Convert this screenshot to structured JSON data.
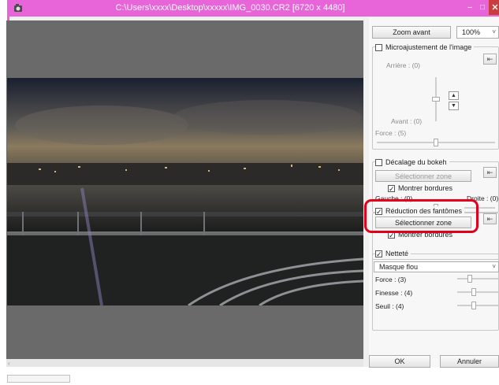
{
  "window": {
    "title": "C:\\Users\\xxxx\\Desktop\\xxxxx\\IMG_0030.CR2 [6720 x 4480]",
    "controls": {
      "minimize": "–",
      "maximize": "□"
    },
    "titlebar_color": "#e865d9",
    "close_color": "#c93d3d"
  },
  "toolbar": {
    "zoom_button": "Zoom avant",
    "zoom_level": "100%"
  },
  "micro": {
    "label": "Microajustement de l'image",
    "checked": false,
    "arriere": "Arrière : (0)",
    "avant": "Avant : (0)",
    "force": "Force : (5)",
    "arriere_value": 0,
    "force_value": 5
  },
  "bokeh": {
    "label": "Décalage du bokeh",
    "checked": false,
    "select_zone": "Sélectionner zone",
    "show_borders": "Montrer bordures",
    "show_borders_checked": true,
    "left": "Gauche : (0)",
    "right": "Droite : (0)",
    "value": 0
  },
  "ghost": {
    "label": "Réduction des fantômes",
    "checked": true,
    "select_zone": "Sélectionner zone",
    "show_borders": "Montrer bordures",
    "show_borders_checked": true
  },
  "sharpness": {
    "label": "Netteté",
    "checked": true,
    "mode": "Masque flou",
    "force": "Force : (3)",
    "finesse": "Finesse : (4)",
    "seuil": "Seuil : (4)",
    "force_value": 3,
    "finesse_value": 4,
    "seuil_value": 4
  },
  "footer": {
    "ok": "OK",
    "cancel": "Annuler"
  },
  "highlight_color": "#e3001b"
}
